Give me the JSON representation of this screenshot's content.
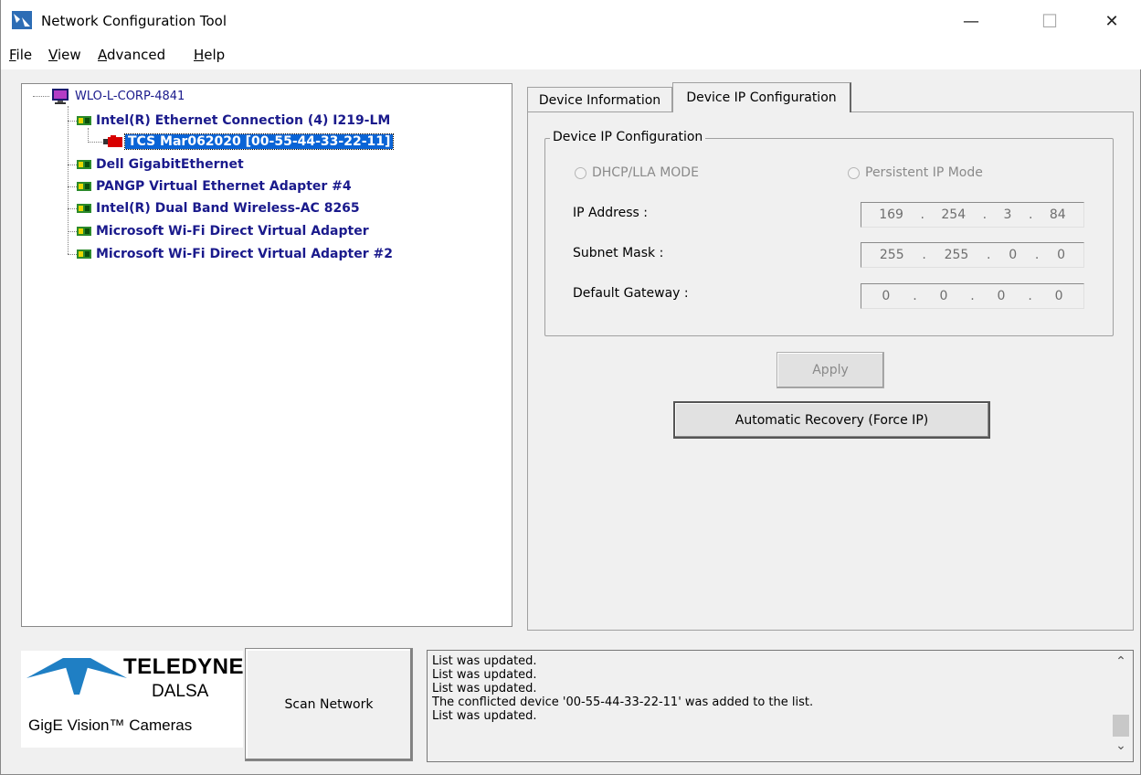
{
  "window": {
    "title": "Network Configuration Tool",
    "controls": {
      "minimize": "—",
      "maximize": "☐",
      "close": "✕"
    }
  },
  "menu": [
    {
      "hotkey": "F",
      "rest": "ile"
    },
    {
      "hotkey": "V",
      "rest": "iew"
    },
    {
      "hotkey": "A",
      "rest": "dvanced"
    },
    {
      "hotkey": "H",
      "rest": "elp"
    }
  ],
  "tree": {
    "host": "WLO-L-CORP-4841",
    "adapters": [
      "Intel(R) Ethernet Connection (4) I219-LM",
      "Dell GigabitEthernet",
      "PANGP Virtual Ethernet Adapter #4",
      "Intel(R) Dual Band Wireless-AC 8265",
      "Microsoft Wi-Fi Direct Virtual Adapter",
      "Microsoft Wi-Fi Direct Virtual Adapter #2"
    ],
    "selected_device": "TCS Mar062020 [00-55-44-33-22-11]"
  },
  "tabs": {
    "device_information": "Device Information",
    "device_ip_configuration": "Device IP Configuration"
  },
  "ip_config": {
    "group_title": "Device IP Configuration",
    "mode_dhcp": "DHCP/LLA MODE",
    "mode_persistent": "Persistent IP Mode",
    "ip_address_label": "IP Address :",
    "ip_address": [
      "169",
      "254",
      "3",
      "84"
    ],
    "subnet_mask_label": "Subnet Mask :",
    "subnet_mask": [
      "255",
      "255",
      "0",
      "0"
    ],
    "default_gateway_label": "Default Gateway :",
    "default_gateway": [
      "0",
      "0",
      "0",
      "0"
    ],
    "apply_label": "Apply",
    "recovery_label": "Automatic Recovery (Force IP)"
  },
  "logo": {
    "brand": "TELEDYNE",
    "sub_brand": "DALSA",
    "tagline": "GigE Vision™ Cameras",
    "brand_color": "#1f7fc4"
  },
  "scan_label": "Scan Network",
  "log": [
    "List was updated.",
    "List was updated.",
    "List was updated.",
    "The conflicted device '00-55-44-33-22-11' was added to the list.",
    "List was updated."
  ]
}
